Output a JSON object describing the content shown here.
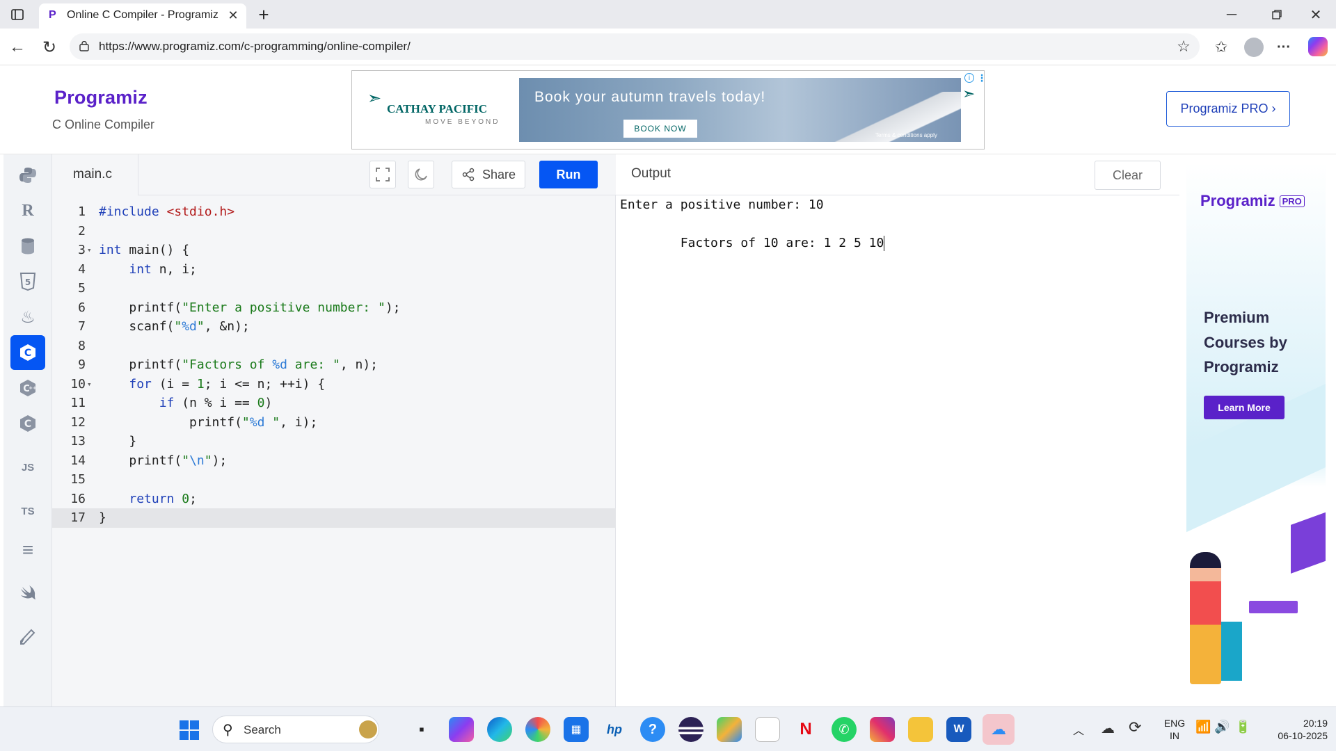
{
  "browser": {
    "tab_title": "Online C Compiler - Programiz",
    "url": "https://www.programiz.com/c-programming/online-compiler/",
    "new_tab_label": "+"
  },
  "site": {
    "logo_text": "Programiz",
    "subtitle": "C Online Compiler",
    "pro_button": "Programiz PRO ›"
  },
  "ad_banner": {
    "brand": "CATHAY PACIFIC",
    "tagline": "MOVE BEYOND",
    "headline": "Book your autumn travels today!",
    "cta": "BOOK NOW",
    "terms": "Terms & conditions apply"
  },
  "sidebar": {
    "items": [
      {
        "name": "python-icon",
        "label": ""
      },
      {
        "name": "r-icon",
        "label": "R"
      },
      {
        "name": "sql-icon",
        "label": ""
      },
      {
        "name": "html-icon",
        "label": "5"
      },
      {
        "name": "java-icon",
        "label": "♨"
      },
      {
        "name": "c-icon",
        "label": "C"
      },
      {
        "name": "cpp-icon",
        "label": "C"
      },
      {
        "name": "csharp-icon",
        "label": "C"
      },
      {
        "name": "js-icon",
        "label": "JS"
      },
      {
        "name": "ts-icon",
        "label": "TS"
      },
      {
        "name": "go-icon",
        "label": "≡"
      },
      {
        "name": "swift-icon",
        "label": ""
      },
      {
        "name": "rust-icon",
        "label": ""
      }
    ]
  },
  "editor": {
    "filename": "main.c",
    "share_label": "Share",
    "run_label": "Run",
    "lines": [
      {
        "n": "1",
        "html": "<span class=\"kw\">#include</span> <span class=\"inc\">&lt;stdio.h&gt;</span>"
      },
      {
        "n": "2",
        "html": ""
      },
      {
        "n": "3",
        "html": "<span class=\"kw\">int</span> main() {",
        "fold": true
      },
      {
        "n": "4",
        "html": "    <span class=\"kw\">int</span> n, i;"
      },
      {
        "n": "5",
        "html": ""
      },
      {
        "n": "6",
        "html": "    printf(<span class=\"str\">\"Enter a positive number: \"</span>);"
      },
      {
        "n": "7",
        "html": "    scanf(<span class=\"str\">\"<span class=\"esc\">%d</span>\"</span>, &amp;n);"
      },
      {
        "n": "8",
        "html": ""
      },
      {
        "n": "9",
        "html": "    printf(<span class=\"str\">\"Factors of <span class=\"esc\">%d</span> are: \"</span>, n);"
      },
      {
        "n": "10",
        "html": "    <span class=\"kw\">for</span> (i = <span class=\"num\">1</span>; i &lt;= n; ++i) {",
        "fold": true
      },
      {
        "n": "11",
        "html": "        <span class=\"kw\">if</span> (n % i == <span class=\"num\">0</span>)"
      },
      {
        "n": "12",
        "html": "            printf(<span class=\"str\">\"<span class=\"esc\">%d</span> \"</span>, i);"
      },
      {
        "n": "13",
        "html": "    }"
      },
      {
        "n": "14",
        "html": "    printf(<span class=\"str\">\"<span class=\"esc\">\\n</span>\"</span>);"
      },
      {
        "n": "15",
        "html": ""
      },
      {
        "n": "16",
        "html": "    <span class=\"kw\">return</span> <span class=\"num\">0</span>;"
      },
      {
        "n": "17",
        "html": "}",
        "active": true
      }
    ]
  },
  "output": {
    "title": "Output",
    "clear_label": "Clear",
    "lines": [
      "Enter a positive number: 10",
      "Factors of 10 are: 1 2 5 10"
    ]
  },
  "right_ad": {
    "logo": "Programiz",
    "badge": "PRO",
    "headline_1": "Premium",
    "headline_2": "Courses by",
    "headline_3": "Programiz",
    "cta": "Learn More"
  },
  "taskbar": {
    "search_placeholder": "Search",
    "lang_1": "ENG",
    "lang_2": "IN",
    "time": "20:19",
    "date": "06-10-2025"
  },
  "colors": {
    "run_blue": "#0556f3",
    "brand_purple": "#5a21c9",
    "active_sidebar": "#0556f3"
  }
}
